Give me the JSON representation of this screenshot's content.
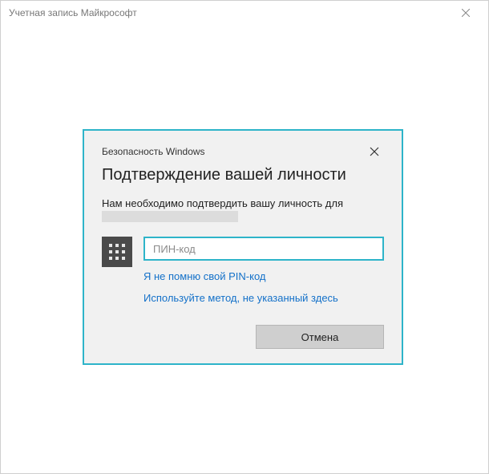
{
  "outer_window": {
    "title": "Учетная запись Майкрософт"
  },
  "dialog": {
    "subheading": "Безопасность Windows",
    "title": "Подтверждение вашей личности",
    "prompt": "Нам необходимо подтвердить вашу личность для",
    "pin_placeholder": "ПИН-код",
    "link_forgot": "Я не помню свой PIN-код",
    "link_other": "Используйте метод, не указанный здесь",
    "cancel_label": "Отмена"
  }
}
